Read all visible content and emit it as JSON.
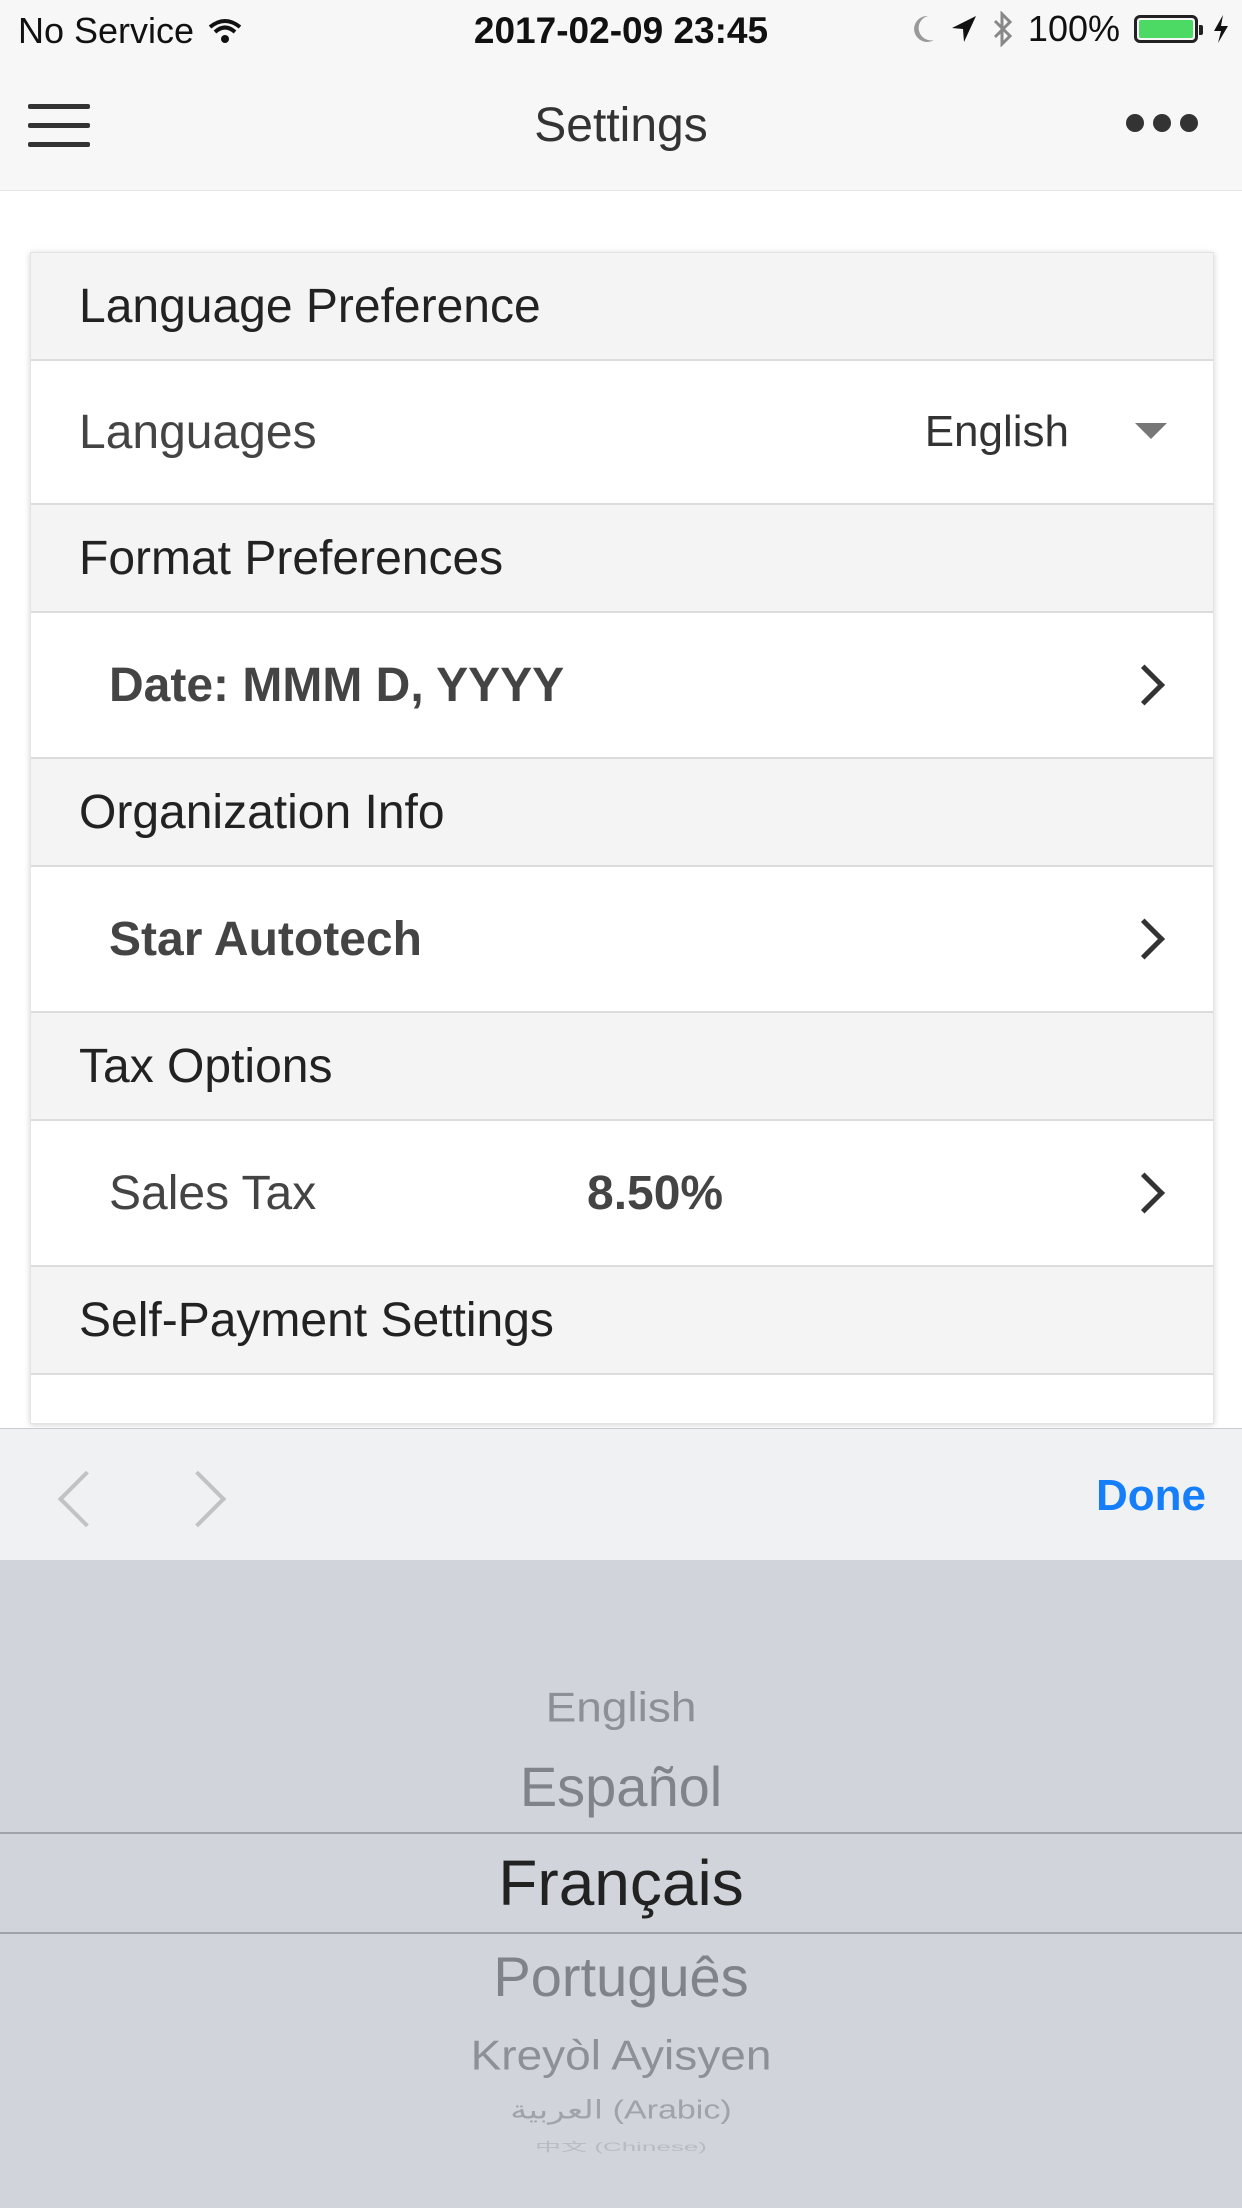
{
  "status_bar": {
    "carrier": "No Service",
    "datetime": "2017-02-09 23:45",
    "battery": "100%",
    "icons": [
      "wifi-icon",
      "moon-icon",
      "location-arrow-icon",
      "bluetooth-icon",
      "battery-icon",
      "charging-bolt-icon"
    ],
    "battery_color": "#4cd964"
  },
  "nav": {
    "title": "Settings",
    "left_icon": "hamburger-menu-icon",
    "right_icon": "more-dots-icon"
  },
  "sections": {
    "language": {
      "header": "Language Preference",
      "row_label": "Languages",
      "row_value": "English"
    },
    "format": {
      "header": "Format Preferences",
      "row_label": "Date: MMM D, YYYY"
    },
    "organization": {
      "header": "Organization Info",
      "row_label": "Star Autotech"
    },
    "tax": {
      "header": "Tax Options",
      "row_label": "Sales Tax",
      "row_value": "8.50%"
    },
    "self_payment": {
      "header": "Self-Payment Settings"
    }
  },
  "toolbar": {
    "done_label": "Done",
    "accent_color": "#147efb"
  },
  "picker": {
    "selected": "Français",
    "options": [
      "English",
      "Español",
      "Français",
      "Português",
      "Kreyòl Ayisyen",
      "العربية (Arabic)",
      "中文 (Chinese)"
    ]
  }
}
